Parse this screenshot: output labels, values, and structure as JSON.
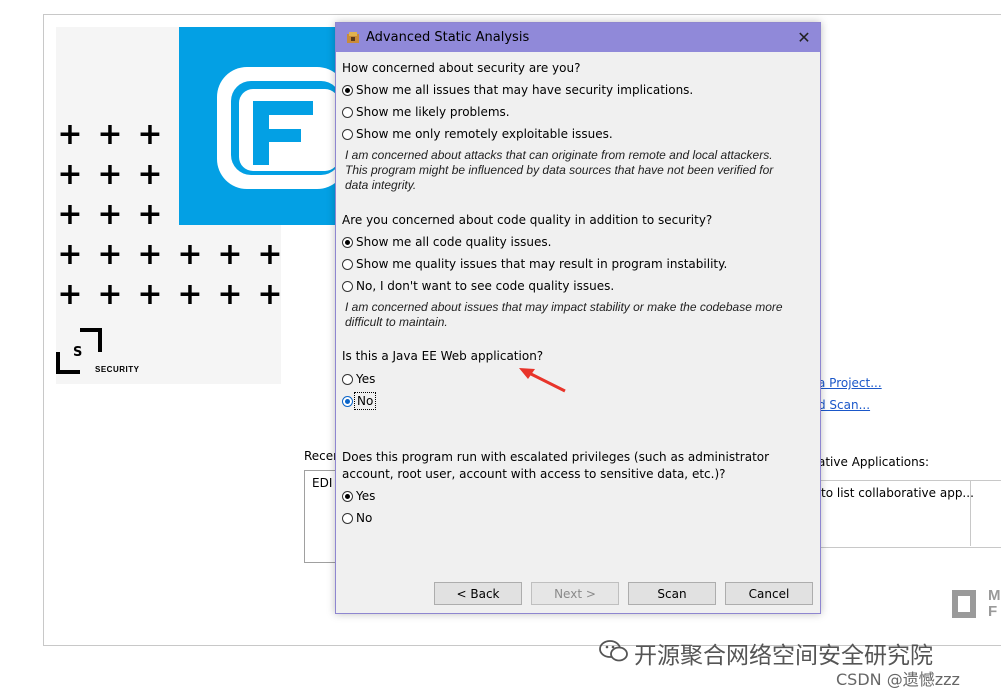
{
  "background": {
    "recent_label": "Recer",
    "recent_item": "EDI",
    "link_project": "a Project...",
    "link_scan": "d Scan...",
    "collab_label": "ative Applications:",
    "collab_item": "to list collaborative app...",
    "security_text": "SECURITY",
    "security_letter": "S",
    "mf_text": "M\nF"
  },
  "dialog": {
    "title": "Advanced Static Analysis",
    "close_glyph": "✕",
    "q1": {
      "question": "How concerned about security are you?",
      "options": [
        "Show me all issues that may have security implications.",
        "Show me likely problems.",
        "Show me only remotely exploitable issues."
      ],
      "selected": 0,
      "note": "I am concerned about attacks that can originate from remote and local attackers. This program might be influenced by data sources that have not been verified for data integrity."
    },
    "q2": {
      "question": "Are you concerned about code quality in addition to security?",
      "options": [
        "Show me all code quality issues.",
        "Show me quality issues that may result in program instability.",
        "No, I don't want to see code quality issues."
      ],
      "selected": 0,
      "note": "I am concerned about issues that may impact stability or make the codebase more difficult to maintain."
    },
    "q3": {
      "question": "Is this a Java EE Web application?",
      "options": [
        "Yes",
        "No"
      ],
      "selected": 1
    },
    "q4": {
      "question_line1": "Does this program run with escalated privileges (such as administrator",
      "question_line2": "account, root user, account with access to sensitive data, etc.)?",
      "options": [
        "Yes",
        "No"
      ],
      "selected": 0
    },
    "buttons": {
      "back": "< Back",
      "next": "Next >",
      "scan": "Scan",
      "cancel": "Cancel"
    }
  },
  "watermark": {
    "line1": "开源聚合网络空间安全研究院",
    "line2": "CSDN @遗憾zzz"
  },
  "colors": {
    "titlebar": "#9089d9",
    "brand_blue": "#03a0e4",
    "link": "#1a57c9",
    "arrow": "#e8342a"
  }
}
